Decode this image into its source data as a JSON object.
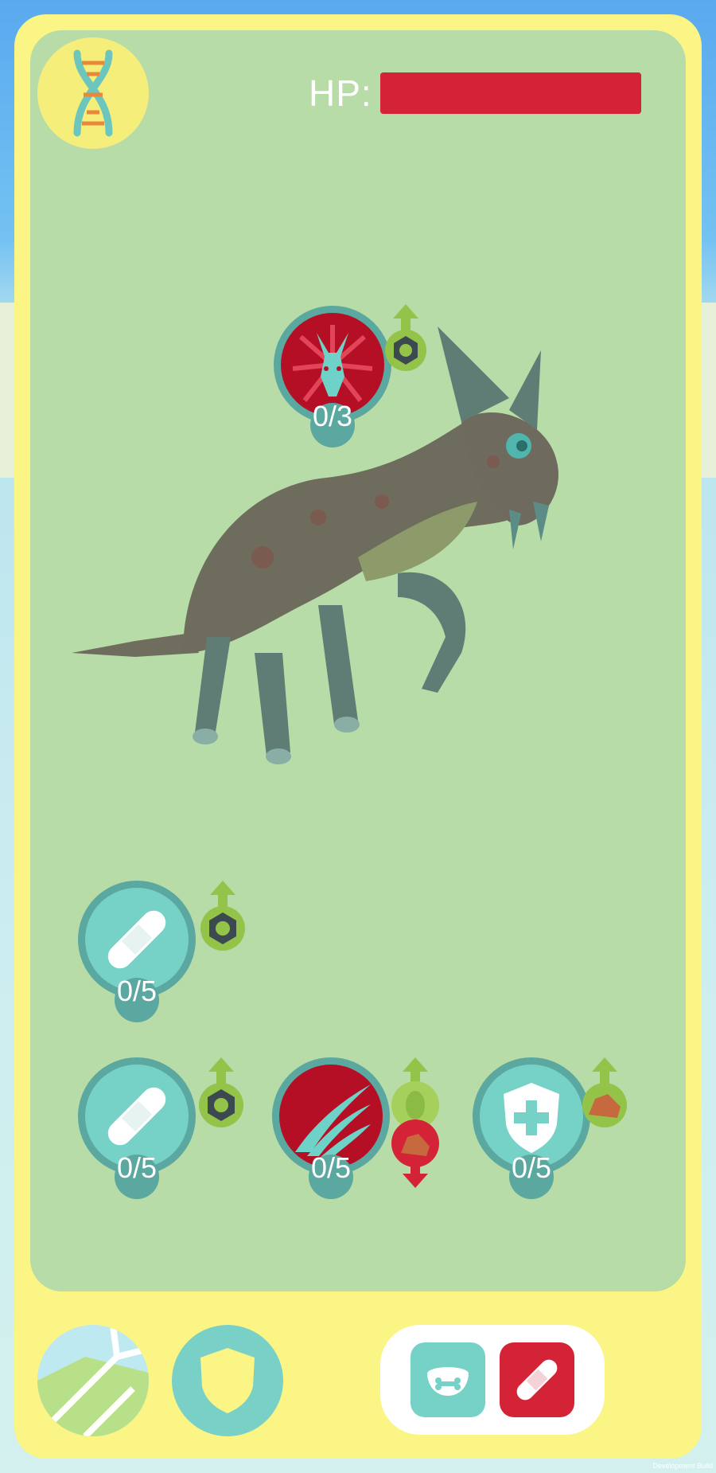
{
  "hud": {
    "hp_label": "HP:",
    "hp_fraction": 1.0,
    "hp_color": "#d42337"
  },
  "icons": {
    "dna": "dna-icon",
    "map": "map-icon",
    "shield": "shield-icon",
    "food": "food-bowl-icon",
    "heal": "bandage-icon"
  },
  "skills": [
    {
      "name": "dragon-head",
      "icon": "dragon-head-icon",
      "count": "0/3"
    },
    {
      "name": "bandage-1",
      "icon": "bandage-icon",
      "count": "0/5"
    },
    {
      "name": "bandage-2",
      "icon": "bandage-icon",
      "count": "0/5"
    },
    {
      "name": "claw",
      "icon": "claw-slash-icon",
      "count": "0/5"
    },
    {
      "name": "shield-plus",
      "icon": "shield-plus-icon",
      "count": "0/5"
    }
  ],
  "colors": {
    "frame": "#fbf585",
    "panel": "#b8dca7",
    "teal": "#76d1c7",
    "red": "#d42337"
  },
  "footer": {
    "dev_build": "Development Build"
  }
}
